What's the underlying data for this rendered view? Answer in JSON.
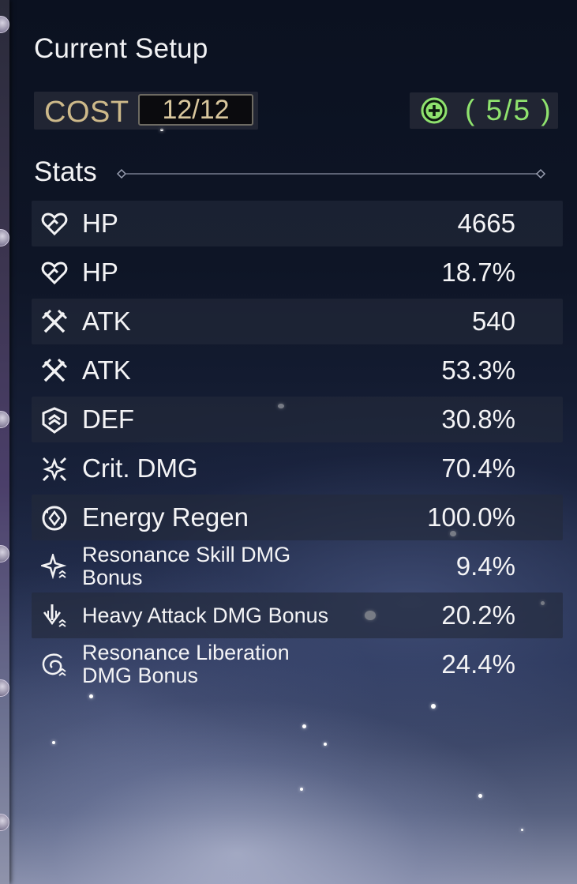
{
  "header": {
    "title": "Current Setup"
  },
  "cost": {
    "label": "COST",
    "value": "12/12"
  },
  "sonata": {
    "icon": "sonata-plus-icon",
    "count": "( 5/5 )",
    "color": "#8fe26e"
  },
  "stats": {
    "heading": "Stats",
    "rows": [
      {
        "icon": "hp-icon",
        "name": "HP",
        "value": "4665"
      },
      {
        "icon": "hp-icon",
        "name": "HP",
        "value": "18.7%"
      },
      {
        "icon": "atk-icon",
        "name": "ATK",
        "value": "540"
      },
      {
        "icon": "atk-icon",
        "name": "ATK",
        "value": "53.3%"
      },
      {
        "icon": "def-icon",
        "name": "DEF",
        "value": "30.8%"
      },
      {
        "icon": "crit-dmg-icon",
        "name": "Crit. DMG",
        "value": "70.4%"
      },
      {
        "icon": "energy-regen-icon",
        "name": "Energy Regen",
        "value": "100.0%"
      },
      {
        "icon": "resonance-skill-icon",
        "name": "Resonance Skill DMG Bonus",
        "value": "9.4%"
      },
      {
        "icon": "heavy-attack-icon",
        "name": "Heavy Attack DMG Bonus",
        "value": "20.2%"
      },
      {
        "icon": "resonance-liberation-icon",
        "name": "Resonance Liberation DMG Bonus",
        "value": "24.4%"
      }
    ]
  }
}
